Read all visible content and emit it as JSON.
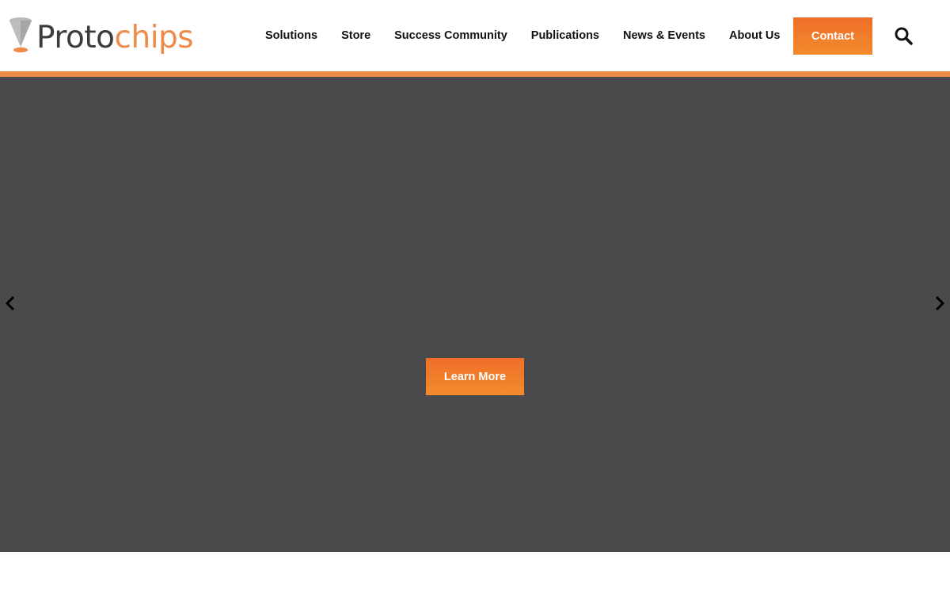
{
  "brand": {
    "name_part1": "Proto",
    "name_part2": "chips",
    "primary_color": "#ee8b44",
    "button_color": "#ef6f2a",
    "text_color": "#3c3c3c"
  },
  "nav": {
    "items": [
      {
        "label": "Solutions"
      },
      {
        "label": "Store"
      },
      {
        "label": "Success Community"
      },
      {
        "label": "Publications"
      },
      {
        "label": "News & Events"
      },
      {
        "label": "About Us"
      }
    ],
    "contact_label": "Contact",
    "search_icon": "search-icon"
  },
  "hero": {
    "background_color": "#4a4a4c",
    "cta_label": "Learn More",
    "prev_icon": "chevron-left-icon",
    "next_icon": "chevron-right-icon"
  }
}
